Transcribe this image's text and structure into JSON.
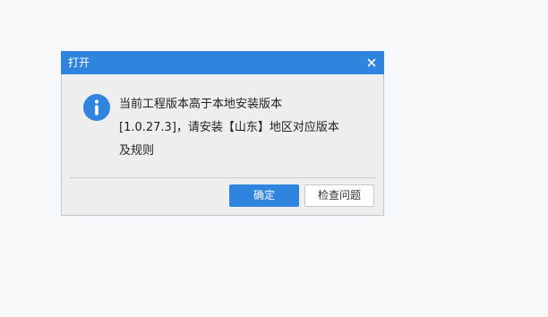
{
  "dialog": {
    "title": "打开",
    "close_symbol": "×",
    "icon": "info-icon",
    "message_lines": [
      "当前工程版本高于本地安装版本",
      "[1.0.27.3]，请安装【山东】地区对应版本",
      "及规则"
    ],
    "buttons": {
      "ok_label": "确定",
      "check_label": "检查问题"
    }
  },
  "colors": {
    "accent": "#2f84de",
    "dialog_bg": "#eeeeee",
    "page_bg": "#f7f8fa"
  }
}
